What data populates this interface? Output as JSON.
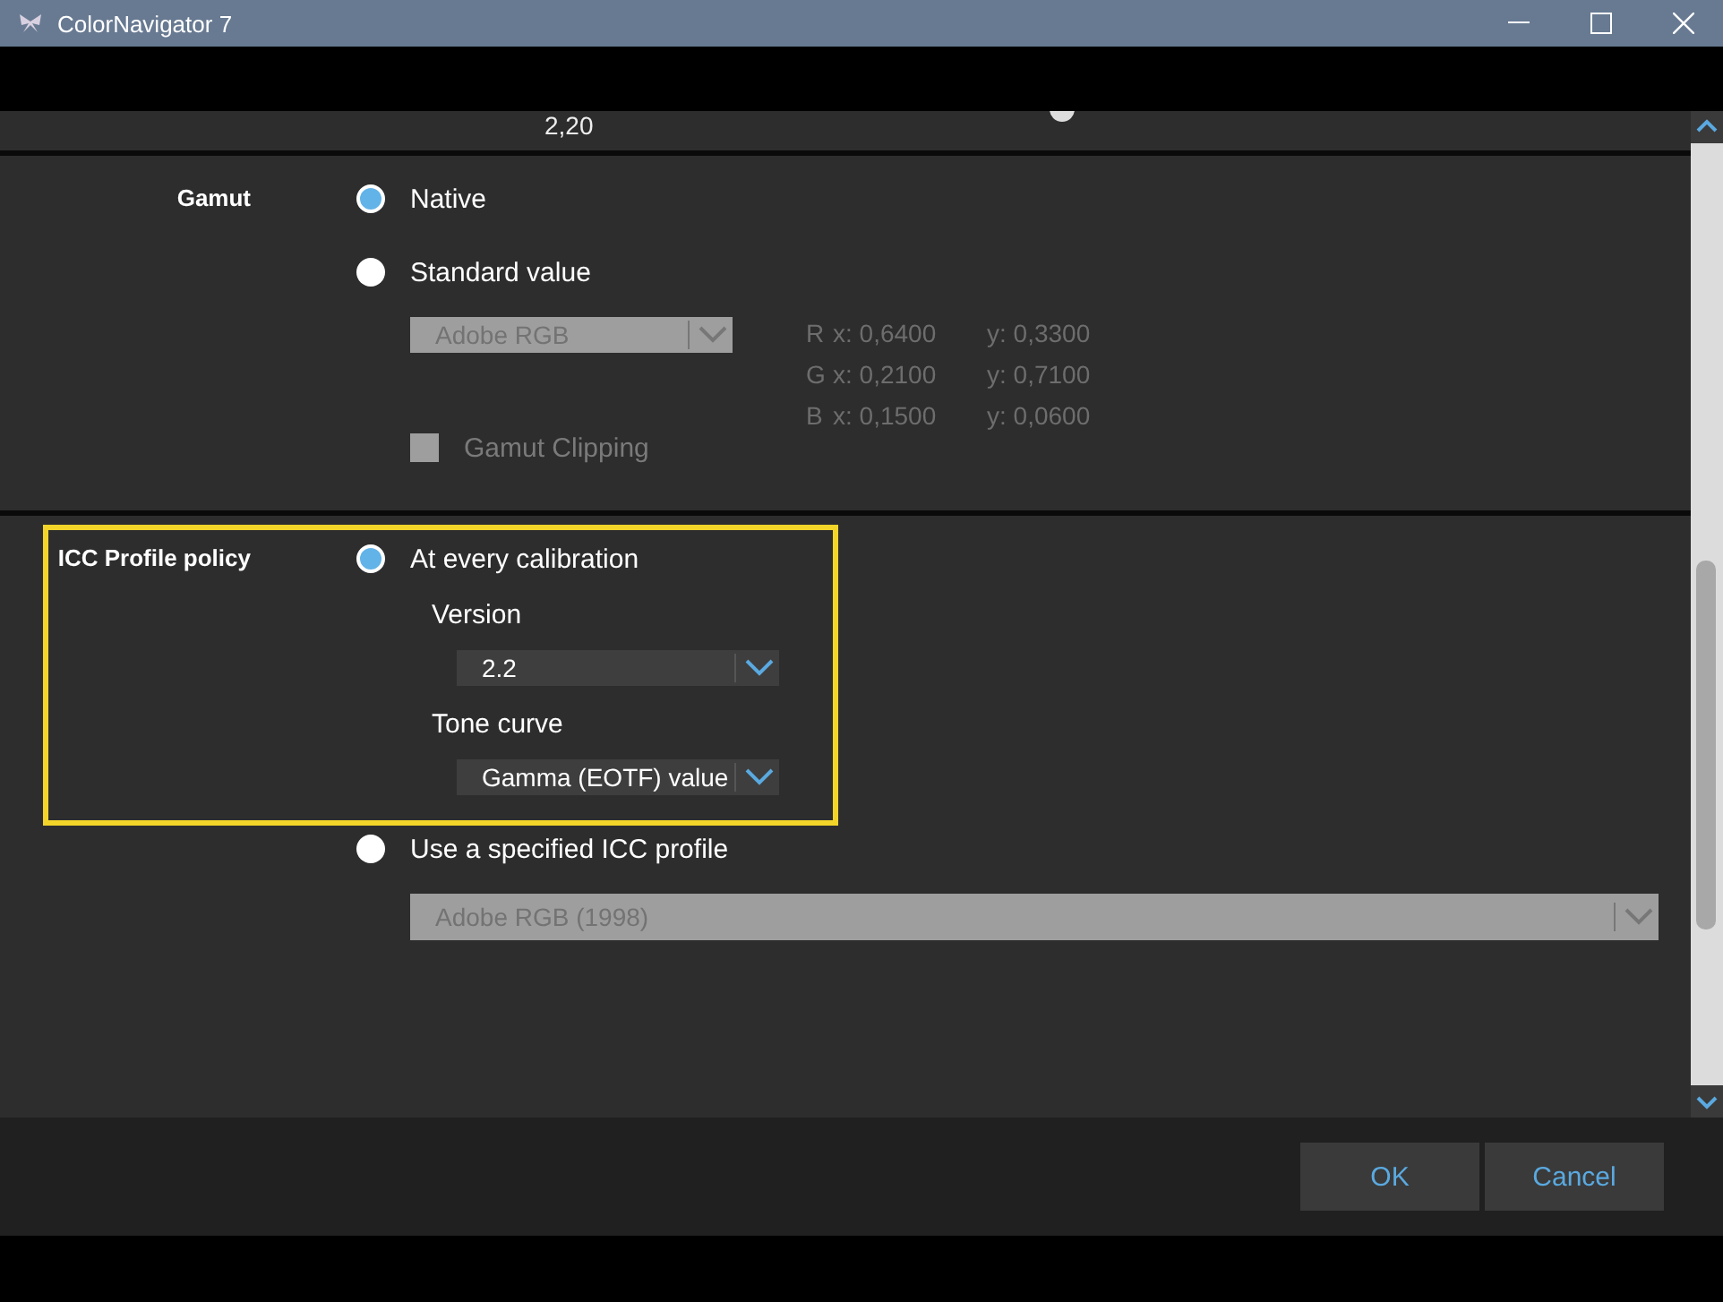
{
  "window": {
    "title": "ColorNavigator 7"
  },
  "top_row": {
    "value": "2,20"
  },
  "sections": [
    {
      "label": "Gamut",
      "options": [
        {
          "label": "Native",
          "selected": true
        },
        {
          "label": "Standard value",
          "selected": false,
          "dropdown": {
            "value": "Adobe RGB",
            "disabled": true
          },
          "primaries": [
            {
              "channel": "R",
              "x": "x: 0,6400",
              "y": "y: 0,3300"
            },
            {
              "channel": "G",
              "x": "x: 0,2100",
              "y": "y: 0,7100"
            },
            {
              "channel": "B",
              "x": "x: 0,1500",
              "y": "y: 0,0600"
            }
          ],
          "checkbox": {
            "label": "Gamut Clipping",
            "checked": false,
            "disabled": true
          }
        }
      ]
    },
    {
      "label": "ICC Profile policy",
      "highlighted": true,
      "options": [
        {
          "label": "At every calibration",
          "selected": true,
          "fields": [
            {
              "label": "Version",
              "dropdown": {
                "value": "2.2",
                "disabled": false
              }
            },
            {
              "label": "Tone curve",
              "dropdown": {
                "value": "Gamma (EOTF) value",
                "disabled": false
              }
            }
          ]
        },
        {
          "label": "Use a specified ICC profile",
          "selected": false,
          "dropdown": {
            "value": "Adobe RGB (1998)",
            "disabled": true
          }
        }
      ]
    }
  ],
  "buttons": [
    "OK",
    "Cancel"
  ]
}
